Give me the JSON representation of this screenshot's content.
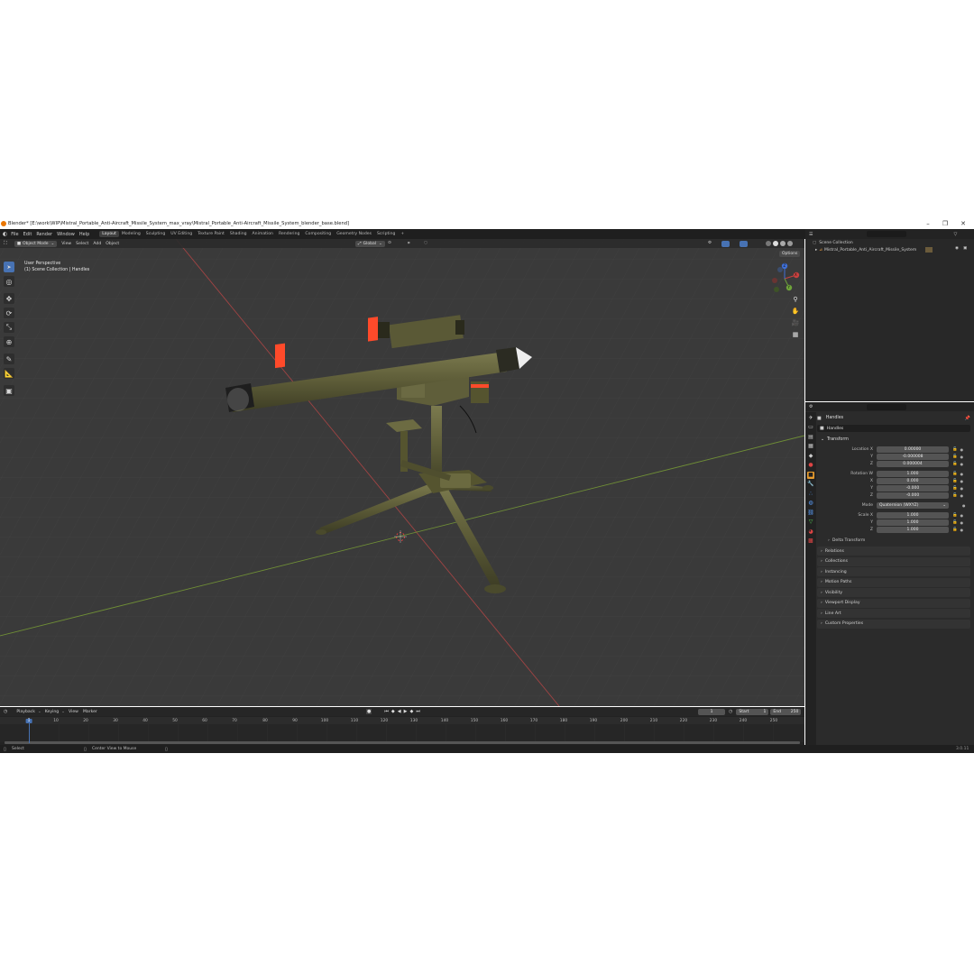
{
  "window": {
    "title": "Blender* [E:\\work\\WIP\\Mistral_Portable_Anti-Aircraft_Missile_System_max_vray\\Mistral_Portable_Anti-Aircraft_Missile_System_blender_base.blend]",
    "minimize": "–",
    "maximize": "❐",
    "close": "✕"
  },
  "menubar": {
    "items": [
      "File",
      "Edit",
      "Render",
      "Window",
      "Help"
    ],
    "workspaces": [
      "Layout",
      "Modeling",
      "Sculpting",
      "UV Editing",
      "Texture Paint",
      "Shading",
      "Animation",
      "Rendering",
      "Compositing",
      "Geometry Nodes",
      "Scripting"
    ],
    "active_workspace": "Layout",
    "add_tab": "+",
    "scene_label": "Scene",
    "view_layer_label": "RenderLayer"
  },
  "viewport": {
    "mode": "Object Mode",
    "menus": [
      "View",
      "Select",
      "Add",
      "Object"
    ],
    "orientation": "Global",
    "options": "Options",
    "overlay_line1": "User Perspective",
    "overlay_line2": "(1) Scene Collection | Handles",
    "gizmo": {
      "x": "X",
      "y": "Y",
      "z": "Z"
    }
  },
  "outliner": {
    "root": "Scene Collection",
    "items": [
      "Mistral_Portable_Anti_Aircraft_Missile_System"
    ]
  },
  "properties": {
    "object_name": "Handles",
    "object_data_name": "Handles",
    "section_transform": "Transform",
    "location": {
      "label": "Location X",
      "x": "0.00000",
      "y": "-0.000008",
      "z": "0.000004"
    },
    "rotation": {
      "label": "Rotation W",
      "w": "1.000",
      "x": "0.000",
      "y": "-0.000",
      "z": "-0.000"
    },
    "axis": {
      "x": "X",
      "y": "Y",
      "z": "Z"
    },
    "mode_label": "Mode",
    "mode_value": "Quaternion (WXYZ)",
    "scale": {
      "label": "Scale X",
      "x": "1.000",
      "y": "1.000",
      "z": "1.000"
    },
    "delta_transform": "Delta Transform",
    "panels": [
      "Relations",
      "Collections",
      "Instancing",
      "Motion Paths",
      "Visibility",
      "Viewport Display",
      "Line Art",
      "Custom Properties"
    ]
  },
  "timeline": {
    "menus": [
      "Playback",
      "Keying",
      "View",
      "Marker"
    ],
    "current_frame": "1",
    "start_label": "Start",
    "start_value": "1",
    "end_label": "End",
    "end_value": "250",
    "ticks": [
      "1",
      "10",
      "20",
      "30",
      "40",
      "50",
      "60",
      "70",
      "80",
      "90",
      "100",
      "110",
      "120",
      "130",
      "140",
      "150",
      "160",
      "170",
      "180",
      "190",
      "200",
      "210",
      "220",
      "230",
      "240",
      "250"
    ]
  },
  "statusbar": {
    "select": "Select",
    "center_view": "Center View to Mouse",
    "version": "3.0.11"
  },
  "colors": {
    "accent": "#4772b3",
    "x_axis": "#b34a4a",
    "y_axis": "#7ea43c",
    "missile_band": "#ff4a2a"
  }
}
